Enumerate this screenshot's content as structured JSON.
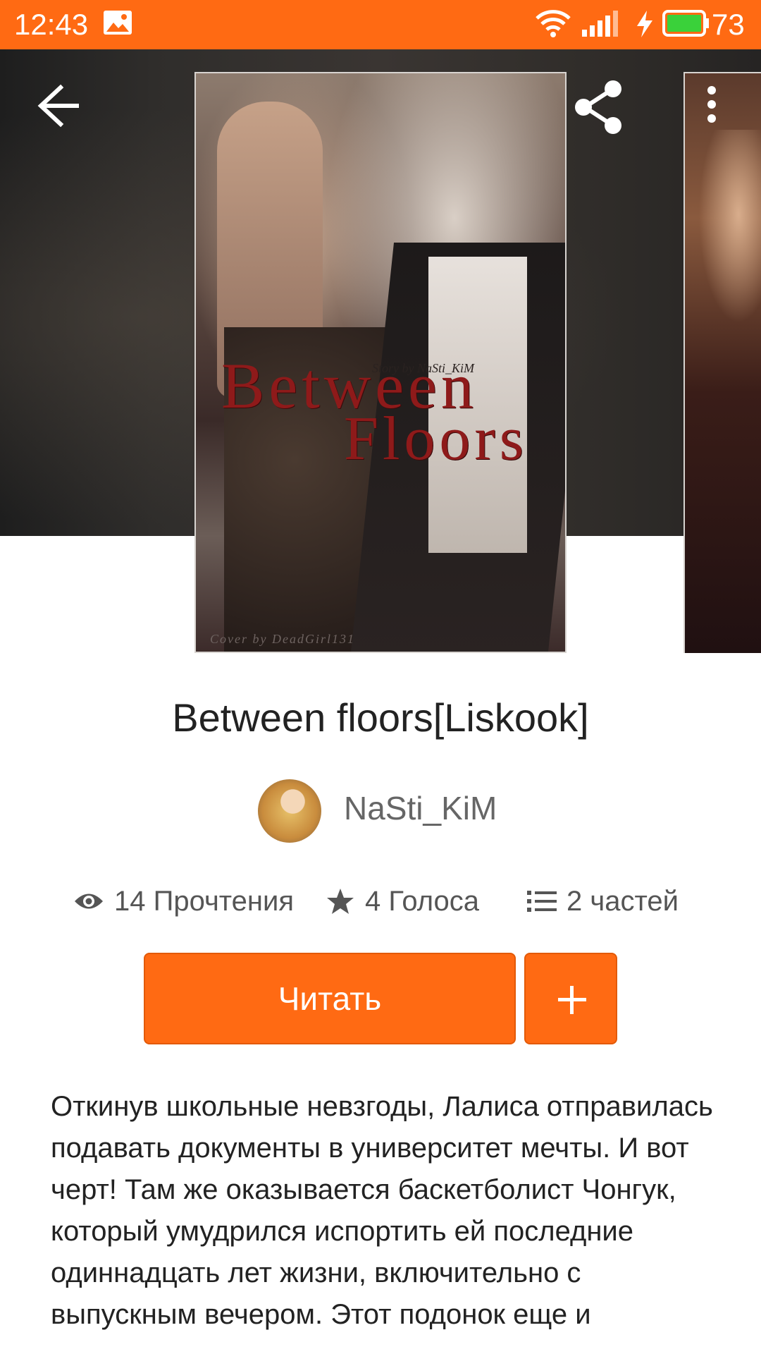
{
  "status_bar": {
    "time": "12:43",
    "battery": "73",
    "accent": "#ff6a13"
  },
  "cover": {
    "title_line_1": "Between",
    "title_line_2": "Floors",
    "small_credit": "Story by NaSti_KiM",
    "bottom_credit": "Cover by DeadGirl131"
  },
  "story": {
    "title": "Between floors[Liskook]",
    "author": "NaSti_KiM",
    "stats": {
      "reads": "14 Прочтения",
      "votes": "4 Голоса",
      "parts": "2 частей"
    },
    "read_label": "Читать",
    "description": "Откинув школьные невзгоды, Лалиса отправилась подавать документы в университет мечты. И вот черт! Там же оказывается баскетболист Чонгук, который умудрился испортить ей последние одиннадцать лет жизни, включительно с выпускным вечером. Этот подонок еще и"
  },
  "icons": {
    "back": "arrow-left-icon",
    "share": "share-icon",
    "more": "more-vert-icon",
    "reads": "eye-icon",
    "votes": "star-icon",
    "parts": "list-icon",
    "add": "plus-icon"
  }
}
